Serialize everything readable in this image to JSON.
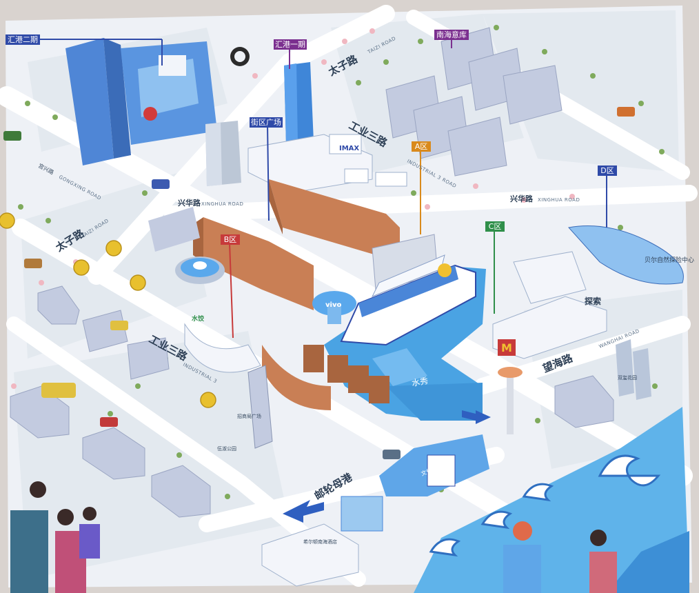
{
  "map": {
    "district_tags": {
      "huigang_phase2": "汇港二期",
      "huigang_phase1": "汇港一期",
      "nanhai_yiku": "南海意库",
      "jiequ_square": "街区广场",
      "zone_a": "A区",
      "zone_b": "B区",
      "zone_c": "C区",
      "zone_d": "D区"
    },
    "roads": {
      "taizi_cn_top": "太子路",
      "taizi_en_top": "TAIZI ROAD",
      "taizi_cn_left": "太子路",
      "taizi_en_left": "TAIZI ROAD",
      "industrial3_cn": "工业三路",
      "industrial3_en": "INDUSTRIAL 3 ROAD",
      "industrial3_cn_lower": "工业三路",
      "industrial3_en_lower": "INDUSTRIAL 3",
      "xinghua_cn_right": "兴华路",
      "xinghua_en_right": "XINGHUA ROAD",
      "xinghua_cn_left": "兴华路",
      "xinghua_en_left": "XINGHUA ROAD",
      "wanghai_cn": "望海路",
      "wanghai_en": "WANGHAI ROAD",
      "youlun_cn": "邮轮母港",
      "gongye_cn_left": "宫兴路",
      "gongye_en_left": "GONGXING ROAD"
    },
    "landmarks": {
      "mingwah_ship": "明华轮",
      "water_show": "水秀",
      "nature_center": "贝尔自然探险中心",
      "culture_center": "文化艺术中心",
      "hilton_hotel": "希尔顿南海酒店",
      "zhaoshang_square": "招商局广场",
      "seaside_garden": "双玺花园",
      "weiyu_park": "伍淑公园",
      "imax": "IMAX",
      "tansuo": "探索",
      "vivo": "vivo",
      "shuibao": "水饺",
      "mcd": "M"
    }
  },
  "colors": {
    "tag_blue": "#2f4aa8",
    "tag_purple": "#7b2f8f",
    "tag_orange": "#d98a1c",
    "tag_red": "#c73a3a",
    "tag_green": "#2f8f4a",
    "water": "#4aa3e3",
    "ground": "#eef1f6",
    "road": "#ffffff",
    "grass": "#dfe7ee",
    "tree": "#7faa5c",
    "blossom": "#f0b7c1"
  }
}
